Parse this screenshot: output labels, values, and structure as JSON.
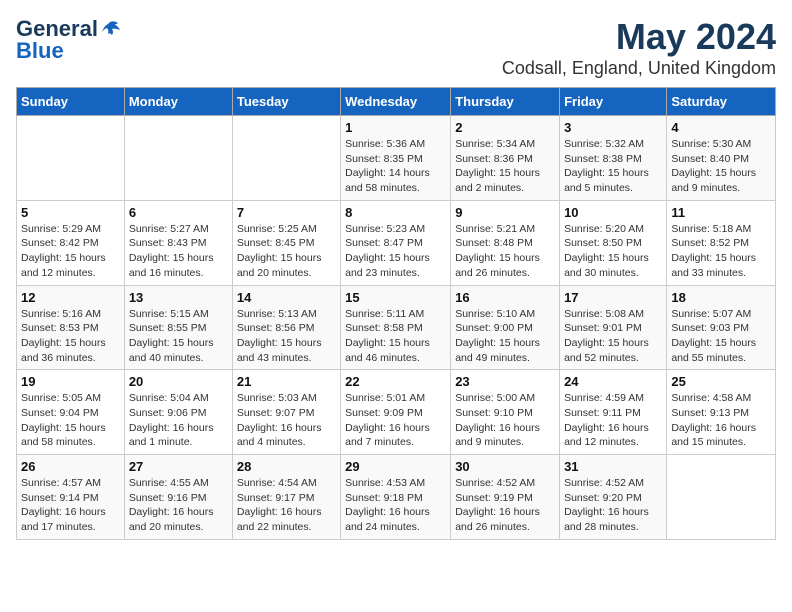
{
  "logo": {
    "line1": "General",
    "line2": "Blue"
  },
  "title": "May 2024",
  "subtitle": "Codsall, England, United Kingdom",
  "days_of_week": [
    "Sunday",
    "Monday",
    "Tuesday",
    "Wednesday",
    "Thursday",
    "Friday",
    "Saturday"
  ],
  "weeks": [
    [
      {
        "day": "",
        "info": ""
      },
      {
        "day": "",
        "info": ""
      },
      {
        "day": "",
        "info": ""
      },
      {
        "day": "1",
        "info": "Sunrise: 5:36 AM\nSunset: 8:35 PM\nDaylight: 14 hours\nand 58 minutes."
      },
      {
        "day": "2",
        "info": "Sunrise: 5:34 AM\nSunset: 8:36 PM\nDaylight: 15 hours\nand 2 minutes."
      },
      {
        "day": "3",
        "info": "Sunrise: 5:32 AM\nSunset: 8:38 PM\nDaylight: 15 hours\nand 5 minutes."
      },
      {
        "day": "4",
        "info": "Sunrise: 5:30 AM\nSunset: 8:40 PM\nDaylight: 15 hours\nand 9 minutes."
      }
    ],
    [
      {
        "day": "5",
        "info": "Sunrise: 5:29 AM\nSunset: 8:42 PM\nDaylight: 15 hours\nand 12 minutes."
      },
      {
        "day": "6",
        "info": "Sunrise: 5:27 AM\nSunset: 8:43 PM\nDaylight: 15 hours\nand 16 minutes."
      },
      {
        "day": "7",
        "info": "Sunrise: 5:25 AM\nSunset: 8:45 PM\nDaylight: 15 hours\nand 20 minutes."
      },
      {
        "day": "8",
        "info": "Sunrise: 5:23 AM\nSunset: 8:47 PM\nDaylight: 15 hours\nand 23 minutes."
      },
      {
        "day": "9",
        "info": "Sunrise: 5:21 AM\nSunset: 8:48 PM\nDaylight: 15 hours\nand 26 minutes."
      },
      {
        "day": "10",
        "info": "Sunrise: 5:20 AM\nSunset: 8:50 PM\nDaylight: 15 hours\nand 30 minutes."
      },
      {
        "day": "11",
        "info": "Sunrise: 5:18 AM\nSunset: 8:52 PM\nDaylight: 15 hours\nand 33 minutes."
      }
    ],
    [
      {
        "day": "12",
        "info": "Sunrise: 5:16 AM\nSunset: 8:53 PM\nDaylight: 15 hours\nand 36 minutes."
      },
      {
        "day": "13",
        "info": "Sunrise: 5:15 AM\nSunset: 8:55 PM\nDaylight: 15 hours\nand 40 minutes."
      },
      {
        "day": "14",
        "info": "Sunrise: 5:13 AM\nSunset: 8:56 PM\nDaylight: 15 hours\nand 43 minutes."
      },
      {
        "day": "15",
        "info": "Sunrise: 5:11 AM\nSunset: 8:58 PM\nDaylight: 15 hours\nand 46 minutes."
      },
      {
        "day": "16",
        "info": "Sunrise: 5:10 AM\nSunset: 9:00 PM\nDaylight: 15 hours\nand 49 minutes."
      },
      {
        "day": "17",
        "info": "Sunrise: 5:08 AM\nSunset: 9:01 PM\nDaylight: 15 hours\nand 52 minutes."
      },
      {
        "day": "18",
        "info": "Sunrise: 5:07 AM\nSunset: 9:03 PM\nDaylight: 15 hours\nand 55 minutes."
      }
    ],
    [
      {
        "day": "19",
        "info": "Sunrise: 5:05 AM\nSunset: 9:04 PM\nDaylight: 15 hours\nand 58 minutes."
      },
      {
        "day": "20",
        "info": "Sunrise: 5:04 AM\nSunset: 9:06 PM\nDaylight: 16 hours\nand 1 minute."
      },
      {
        "day": "21",
        "info": "Sunrise: 5:03 AM\nSunset: 9:07 PM\nDaylight: 16 hours\nand 4 minutes."
      },
      {
        "day": "22",
        "info": "Sunrise: 5:01 AM\nSunset: 9:09 PM\nDaylight: 16 hours\nand 7 minutes."
      },
      {
        "day": "23",
        "info": "Sunrise: 5:00 AM\nSunset: 9:10 PM\nDaylight: 16 hours\nand 9 minutes."
      },
      {
        "day": "24",
        "info": "Sunrise: 4:59 AM\nSunset: 9:11 PM\nDaylight: 16 hours\nand 12 minutes."
      },
      {
        "day": "25",
        "info": "Sunrise: 4:58 AM\nSunset: 9:13 PM\nDaylight: 16 hours\nand 15 minutes."
      }
    ],
    [
      {
        "day": "26",
        "info": "Sunrise: 4:57 AM\nSunset: 9:14 PM\nDaylight: 16 hours\nand 17 minutes."
      },
      {
        "day": "27",
        "info": "Sunrise: 4:55 AM\nSunset: 9:16 PM\nDaylight: 16 hours\nand 20 minutes."
      },
      {
        "day": "28",
        "info": "Sunrise: 4:54 AM\nSunset: 9:17 PM\nDaylight: 16 hours\nand 22 minutes."
      },
      {
        "day": "29",
        "info": "Sunrise: 4:53 AM\nSunset: 9:18 PM\nDaylight: 16 hours\nand 24 minutes."
      },
      {
        "day": "30",
        "info": "Sunrise: 4:52 AM\nSunset: 9:19 PM\nDaylight: 16 hours\nand 26 minutes."
      },
      {
        "day": "31",
        "info": "Sunrise: 4:52 AM\nSunset: 9:20 PM\nDaylight: 16 hours\nand 28 minutes."
      },
      {
        "day": "",
        "info": ""
      }
    ]
  ]
}
